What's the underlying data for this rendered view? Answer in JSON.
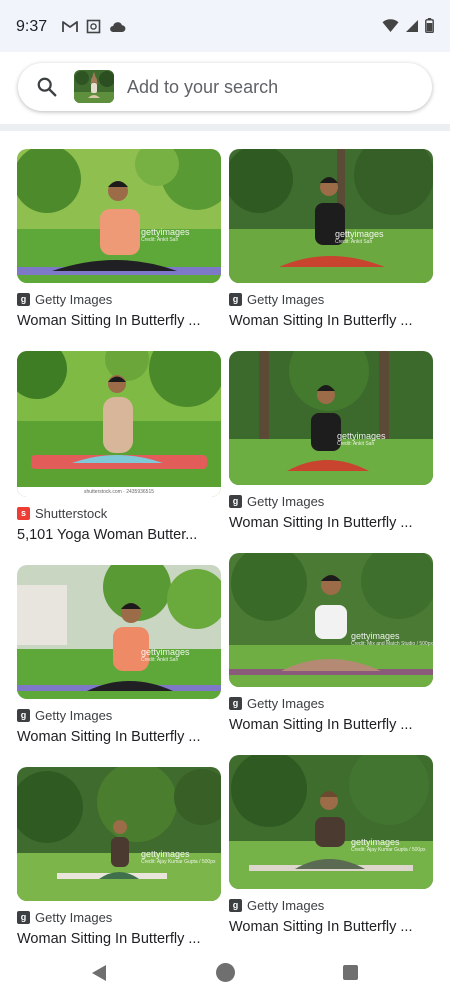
{
  "status_bar": {
    "time": "9:37",
    "left_icons": [
      "gmail-icon",
      "screenshot-icon",
      "cloud-icon"
    ],
    "right_icons": [
      "wifi-icon",
      "signal-icon",
      "battery-icon"
    ]
  },
  "search": {
    "placeholder": "Add to your search",
    "icon": "search-icon",
    "thumbnail": "query-image-thumbnail"
  },
  "results": {
    "left": [
      {
        "source": "Getty Images",
        "source_type": "getty",
        "title": "Woman Sitting In Butterfly ...",
        "watermark": "gettyimages",
        "credit": "Credit: Ankit Sah"
      },
      {
        "source": "Shutterstock",
        "source_type": "shutter",
        "title": "5,101 Yoga Woman Butter...",
        "bottom_text": "shutterstock.com · 2435936515"
      },
      {
        "source": "Getty Images",
        "source_type": "getty",
        "title": "Woman Sitting In Butterfly ...",
        "watermark": "gettyimages",
        "credit": "Credit: Ankit Sah"
      },
      {
        "source": "Getty Images",
        "source_type": "getty",
        "title": "Woman Sitting In Butterfly ...",
        "watermark": "gettyimages",
        "credit": "Credit: Ajay Kumar Gupta / 500px"
      }
    ],
    "right": [
      {
        "source": "Getty Images",
        "source_type": "getty",
        "title": "Woman Sitting In Butterfly ...",
        "watermark": "gettyimages",
        "credit": "Credit: Ankit Sah"
      },
      {
        "source": "Getty Images",
        "source_type": "getty",
        "title": "Woman Sitting In Butterfly ...",
        "watermark": "gettyimages",
        "credit": "Credit: Ankit Sah"
      },
      {
        "source": "Getty Images",
        "source_type": "getty",
        "title": "Woman Sitting In Butterfly ...",
        "watermark": "gettyimages",
        "credit": "Credit: Mix and Match Studio / 500px"
      },
      {
        "source": "Getty Images",
        "source_type": "getty",
        "title": "Woman Sitting In Butterfly ...",
        "watermark": "gettyimages",
        "credit": "Credit: Ajay Kumar Gupta / 500px"
      }
    ]
  },
  "nav_bar": {
    "icons": [
      "back-icon",
      "home-icon",
      "recents-icon"
    ]
  },
  "colors": {
    "status_bg": "#f1f5fb",
    "grass": "#5ea83a",
    "text": "#202124",
    "muted": "#5f6368"
  }
}
